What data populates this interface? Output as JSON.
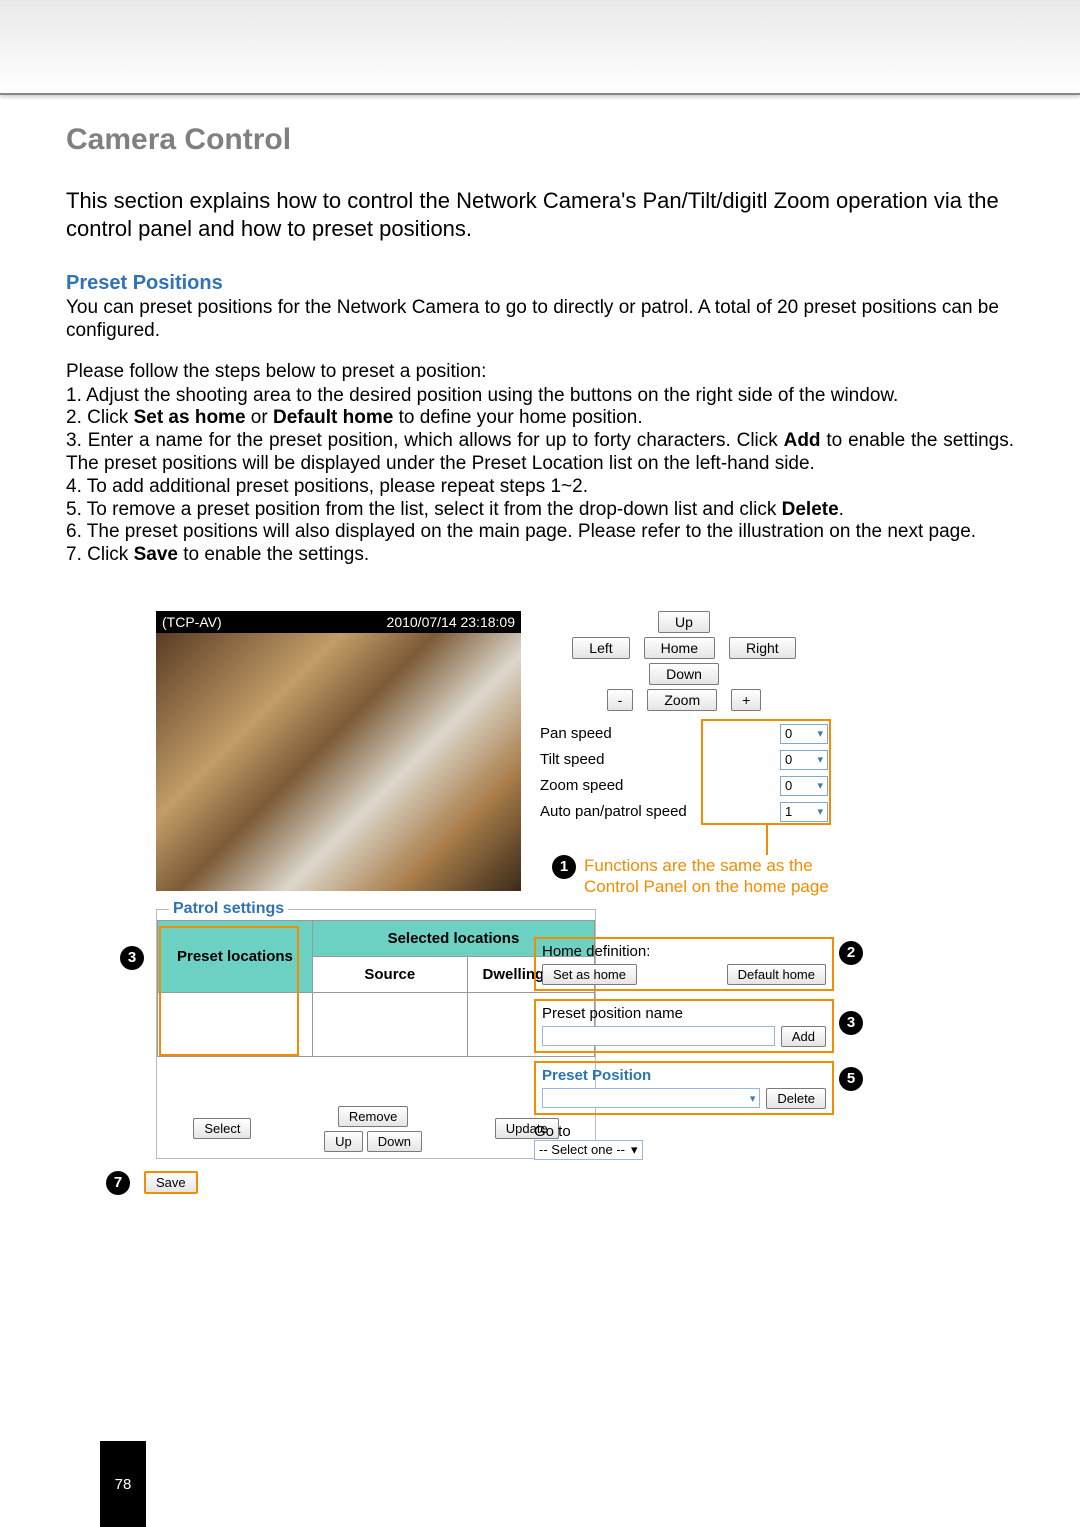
{
  "title": "Camera Control",
  "intro": "This section explains how to control the Network Camera's Pan/Tilt/digitl Zoom operation via the control panel and how to preset positions.",
  "preset_heading": "Preset Positions",
  "preset_text": "You can preset positions for the Network Camera to go to directly or patrol. A total of 20 preset positions can be configured.",
  "steps_intro": "Please follow the steps below to preset a position:",
  "steps": {
    "s1": "1. Adjust the shooting area to the desired position using the buttons on the right side of the window.",
    "s2a": "2. Click ",
    "s2b": "Set as home",
    "s2c": " or ",
    "s2d": "Default home",
    "s2e": " to define your home position.",
    "s3a": "3. Enter a name for the preset position, which allows for up to forty characters. Click ",
    "s3b": "Add",
    "s3c": " to enable the settings. The preset positions will be displayed under the Preset Location list on the left-hand side.",
    "s4": "4. To add additional preset positions, please repeat steps 1~2.",
    "s5a": "5. To remove a preset position from the list, select it from the drop-down list and click ",
    "s5b": "Delete",
    "s5c": ".",
    "s6": "6. The preset positions will also displayed on the main page. Please refer to the illustration on the next page.",
    "s7a": "7. Click ",
    "s7b": "Save",
    "s7c": " to enable the settings."
  },
  "video": {
    "left": "(TCP-AV)",
    "right": "2010/07/14 23:18:09"
  },
  "ctrl": {
    "up": "Up",
    "left": "Left",
    "home": "Home",
    "right": "Right",
    "down": "Down",
    "minus": "-",
    "zoom": "Zoom",
    "plus": "+",
    "pan_speed": "Pan speed",
    "tilt_speed": "Tilt speed",
    "zoom_speed": "Zoom speed",
    "auto_speed": "Auto pan/patrol speed",
    "v_pan": "0",
    "v_tilt": "0",
    "v_zoom": "0",
    "v_auto": "1"
  },
  "annot": {
    "n1": "1",
    "n2": "2",
    "n3": "3",
    "n5": "5",
    "n7": "7",
    "note": "Functions are the same as the Control Panel on the home page"
  },
  "patrol": {
    "legend": "Patrol settings",
    "preset_loc": "Preset locations",
    "sel_loc": "Selected locations",
    "source": "Source",
    "dwell": "Dwelling time",
    "select": "Select",
    "remove": "Remove",
    "up": "Up",
    "down": "Down",
    "update": "Update"
  },
  "right": {
    "home_def": "Home definition:",
    "set_home": "Set as home",
    "default_home": "Default home",
    "preset_name": "Preset position name",
    "add": "Add",
    "preset_pos": "Preset Position",
    "delete": "Delete",
    "goto": "Go to",
    "goto_sel": "-- Select one --"
  },
  "save": "Save",
  "page_num": "78"
}
